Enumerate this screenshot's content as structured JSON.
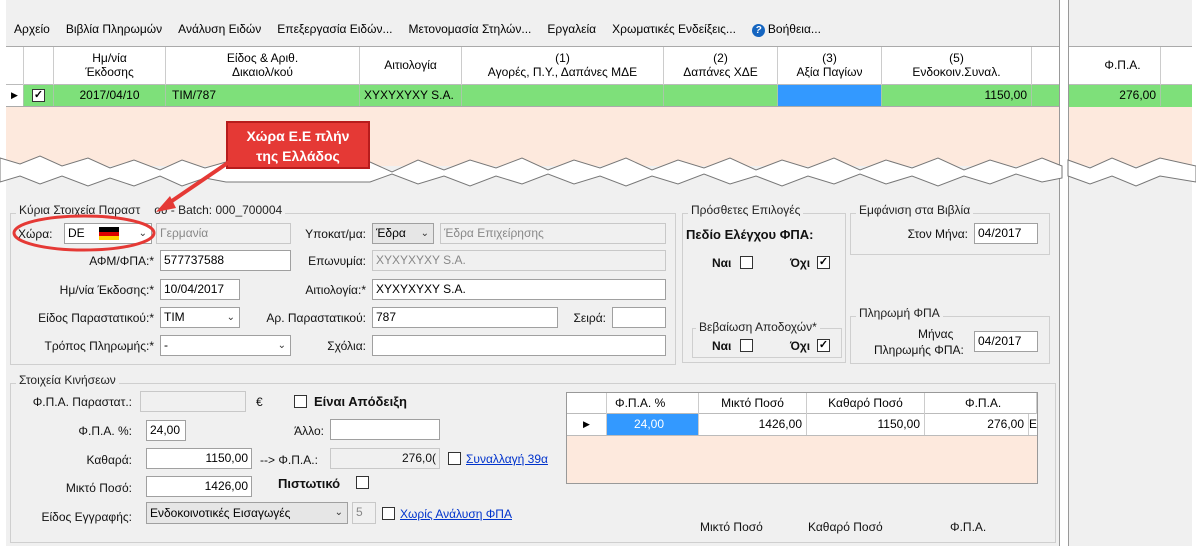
{
  "menu": {
    "items": [
      "Αρχείο",
      "Βιβλία Πληρωμών",
      "Ανάλυση Ειδών",
      "Επεξεργασία Ειδών...",
      "Μετονομασία Στηλών...",
      "Εργαλεία",
      "Χρωματικές Ενδείξεις...",
      "Βοήθεια..."
    ]
  },
  "grid": {
    "headers": [
      "Ημ/νία\nΈκδοσης",
      "Είδος & Αριθ.\nΔικαιολ/κού",
      "Αιτιολογία",
      "(1)\nΑγορές, Π.Υ., Δαπάνες ΜΔΕ",
      "(2)\nΔαπάνες ΧΔΕ",
      "(3)\nΑξία Παγίων",
      "(5)\nΕνδοκοιν.Συναλ."
    ],
    "row": {
      "checked": true,
      "date": "2017/04/10",
      "doc": "TIM/787",
      "reason": "XYXYXYXY S.A.",
      "enkoin": "1150,00"
    },
    "right_header": "Φ.Π.Α.",
    "right_value": "276,00"
  },
  "callout": {
    "line1": "Χώρα Ε.Ε πλήν",
    "line2": "της Ελλάδος"
  },
  "main_group": {
    "title": "Κύρια Στοιχεία Παραστ",
    "title_suffix": "ού - Batch: 000_700004",
    "country_label": "Χώρα:",
    "country_code": "DE",
    "country_name": "Γερμανία",
    "subcat_label": "Υποκατ/μα:",
    "subcat_value": "Έδρα",
    "subcat_desc": "Έδρα Επιχείρησης",
    "afm_label": "ΑΦΜ/ΦΠΑ:*",
    "afm_value": "577737588",
    "name_label": "Επωνυμία:",
    "name_value": "XYXYXYXY S.A.",
    "date_label": "Ημ/νία Έκδοσης:*",
    "date_value": "10/04/2017",
    "reason_label": "Αιτιολογία:*",
    "reason_value": "XYXYXYXY S.A.",
    "doctype_label": "Είδος Παραστατικού:*",
    "doctype_value": "TIM",
    "docno_label": "Αρ. Παραστατικού:",
    "docno_value": "787",
    "series_label": "Σειρά:",
    "series_value": "",
    "payment_label": "Τρόπος Πληρωμής:*",
    "payment_value": "-",
    "comments_label": "Σχόλια:",
    "comments_value": ""
  },
  "extra_group": {
    "title": "Πρόσθετες Επιλογές",
    "vat_check_label": "Πεδίο Ελέγχου ΦΠΑ:",
    "yes": "Ναι",
    "no": "Όχι",
    "income_title": "Βεβαίωση Αποδοχών*",
    "yes2": "Ναι",
    "no2": "Όχι"
  },
  "books_group": {
    "title": "Εμφάνιση στα Βιβλία",
    "month_label": "Στον Μήνα:",
    "month_value": "04/2017"
  },
  "vatpay_group": {
    "title": "Πληρωμή ΦΠΑ",
    "label1": "Μήνας",
    "label2": "Πληρωμής ΦΠΑ:",
    "value": "04/2017"
  },
  "movements": {
    "title": "Στοιχεία Κινήσεων",
    "vat_doc_label": "Φ.Π.Α. Παραστατ.:",
    "vat_doc_value": "",
    "euro": "€",
    "receipt_label": "Είναι Απόδειξη",
    "vat_pct_label": "Φ.Π.Α. %:",
    "vat_pct_value": "24,00",
    "other_label": "Άλλο:",
    "other_value": "",
    "net_label": "Καθαρά:",
    "net_value": "1150,00",
    "arrow_vat_label": "--> Φ.Π.Α.:",
    "arrow_vat_value": "276,0(",
    "tx39_label": "Συναλλαγή 39α",
    "gross_label": "Μικτό Ποσό:",
    "gross_value": "1426,00",
    "credit_label": "Πιστωτικό",
    "entry_type_label": "Είδος Εγγραφής:",
    "entry_type_value": "Ενδοκοινοτικές Εισαγωγές",
    "entry_no": "5",
    "no_analysis_label": "Χωρίς Ανάλυση ΦΠΑ"
  },
  "vat_table": {
    "headers": [
      "Φ.Π.Α. %",
      "Μικτό Ποσό",
      "Καθαρό Ποσό",
      "Φ.Π.Α."
    ],
    "row": [
      "24,00",
      "1426,00",
      "1150,00",
      "276,00"
    ],
    "row_tail": "Ε",
    "footer": [
      "Μικτό Ποσό",
      "Καθαρό Ποσό",
      "Φ.Π.Α."
    ]
  },
  "colors": {
    "row_green": "#7ee07a",
    "grid_bg": "#fde9dd",
    "selected_blue": "#3399ff",
    "callout_red": "#e53935"
  }
}
